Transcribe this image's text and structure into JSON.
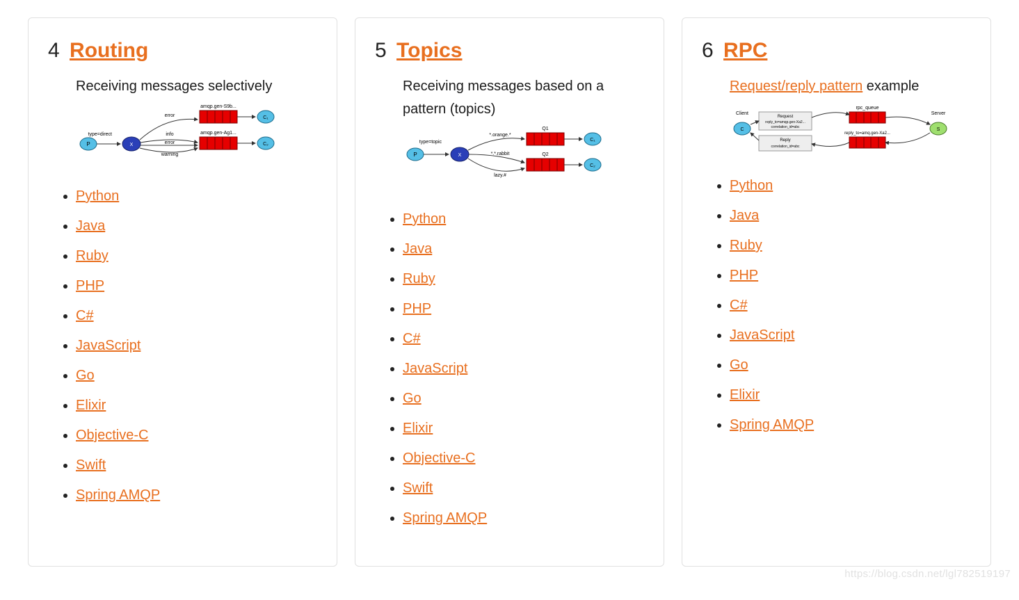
{
  "cards": [
    {
      "num": "4",
      "title": "Routing",
      "desc_plain": "Receiving messages selectively",
      "desc_link": "",
      "desc_after": "",
      "diagram": {
        "q1_label": "amqp.gen-S9b...",
        "q2_label": "amqp.gen-Ag1...",
        "x_label": "type=direct",
        "b1": "error",
        "b2": "info",
        "b3": "error",
        "b4": "warning"
      },
      "langs": [
        "Python",
        "Java",
        "Ruby",
        "PHP",
        "C#",
        "JavaScript",
        "Go",
        "Elixir",
        "Objective-C",
        "Swift",
        "Spring AMQP"
      ]
    },
    {
      "num": "5",
      "title": "Topics",
      "desc_plain": "Receiving messages based on a pattern (topics)",
      "desc_link": "",
      "desc_after": "",
      "diagram": {
        "q1_label": "Q1",
        "q2_label": "Q2",
        "x_label": "type=topic",
        "b1": "*.orange.*",
        "b2": "*.*.rabbit",
        "b3": "lazy.#"
      },
      "langs": [
        "Python",
        "Java",
        "Ruby",
        "PHP",
        "C#",
        "JavaScript",
        "Go",
        "Elixir",
        "Objective-C",
        "Swift",
        "Spring AMQP"
      ]
    },
    {
      "num": "6",
      "title": "RPC",
      "desc_plain": "",
      "desc_link": "Request/reply pattern",
      "desc_after": " example",
      "diagram": {
        "client": "Client",
        "server": "Server",
        "rpc_queue": "rpc_queue",
        "reply_to": "reply_to=amq.gen-Xa2...",
        "req1": "Request",
        "req2": "reply_to=amqp.gen-Xa2...",
        "req3": "correlation_id=abc",
        "rep1": "Reply",
        "rep2": "correlation_id=abc"
      },
      "langs": [
        "Python",
        "Java",
        "Ruby",
        "PHP",
        "C#",
        "JavaScript",
        "Go",
        "Elixir",
        "Spring AMQP"
      ]
    }
  ],
  "watermark": "https://blog.csdn.net/lgl782519197"
}
